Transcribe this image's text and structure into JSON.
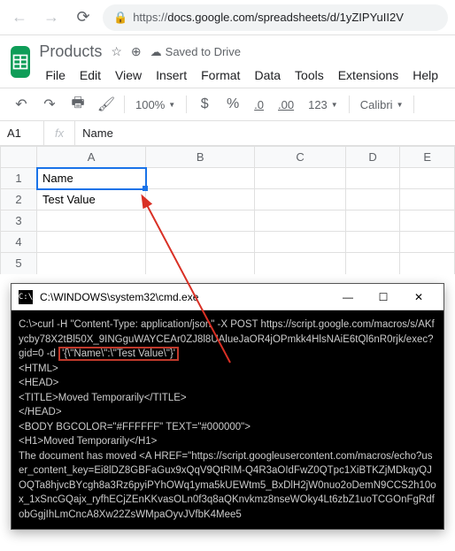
{
  "browser": {
    "url_prefix": "https://",
    "url": "docs.google.com/spreadsheets/d/1yZIPYuII2V"
  },
  "header": {
    "doc_title": "Products",
    "saved_text": "Saved to Drive",
    "menus": [
      "File",
      "Edit",
      "View",
      "Insert",
      "Format",
      "Data",
      "Tools",
      "Extensions",
      "Help"
    ]
  },
  "toolbar": {
    "zoom": "100%",
    "currency": "$",
    "percent": "%",
    "dec_dec": ".0",
    "inc_dec": ".00",
    "num_format": "123",
    "font": "Calibri"
  },
  "formula": {
    "name_box": "A1",
    "fx": "fx",
    "value": "Name"
  },
  "sheet": {
    "cols": [
      "A",
      "B",
      "C",
      "D",
      "E"
    ],
    "rows": [
      {
        "num": "1",
        "cells": [
          "Name",
          "",
          "",
          "",
          ""
        ]
      },
      {
        "num": "2",
        "cells": [
          "Test Value",
          "",
          "",
          "",
          ""
        ]
      },
      {
        "num": "3",
        "cells": [
          "",
          "",
          "",
          "",
          ""
        ]
      },
      {
        "num": "4",
        "cells": [
          "",
          "",
          "",
          "",
          ""
        ]
      },
      {
        "num": "5",
        "cells": [
          "",
          "",
          "",
          "",
          ""
        ]
      }
    ]
  },
  "cmd": {
    "title": "C:\\WINDOWS\\system32\\cmd.exe",
    "line1": "C:\\>curl -H \"Content-Type: application/json\" -X POST https://script.google.com/macros/s/AKfycby78X2tBl50X_9INGguWAYCEAr0ZJ8l8UAlueJaOR4jOPmkk4HlsNAiE6tQl6nR0rjk/exec?gid=0 -d ",
    "highlighted": "'{\\\"Name\\\":\\\"Test Value\\\"}'",
    "line2": "<HTML>",
    "line3": "<HEAD>",
    "line4": "<TITLE>Moved Temporarily</TITLE>",
    "line5": "</HEAD>",
    "line6": "<BODY BGCOLOR=\"#FFFFFF\" TEXT=\"#000000\">",
    "line7": "<H1>Moved Temporarily</H1>",
    "line8": "The document has moved <A HREF=\"https://script.googleusercontent.com/macros/echo?user_content_key=Ei8lDZ8GBFaGux9xQqV9QtRIM-Q4R3aOIdFwZ0QTpc1XiBTKZjMDkqyQJOQTa8hjvcBYcgh8a3Rz6pyiPYhOWq1yma5kUEWtm5_BxDlH2jW0nuo2oDemN9CCS2h10ox_1xSncGQajx_ryfhECjZEnKKvasOLn0f3q8aQKnvkmz8nseWOky4Lt6zbZ1uoTCGOnFgRdfobGgjIhLmCncA8Xw22ZsWMpaOyvJVfbK4Mee5"
  }
}
